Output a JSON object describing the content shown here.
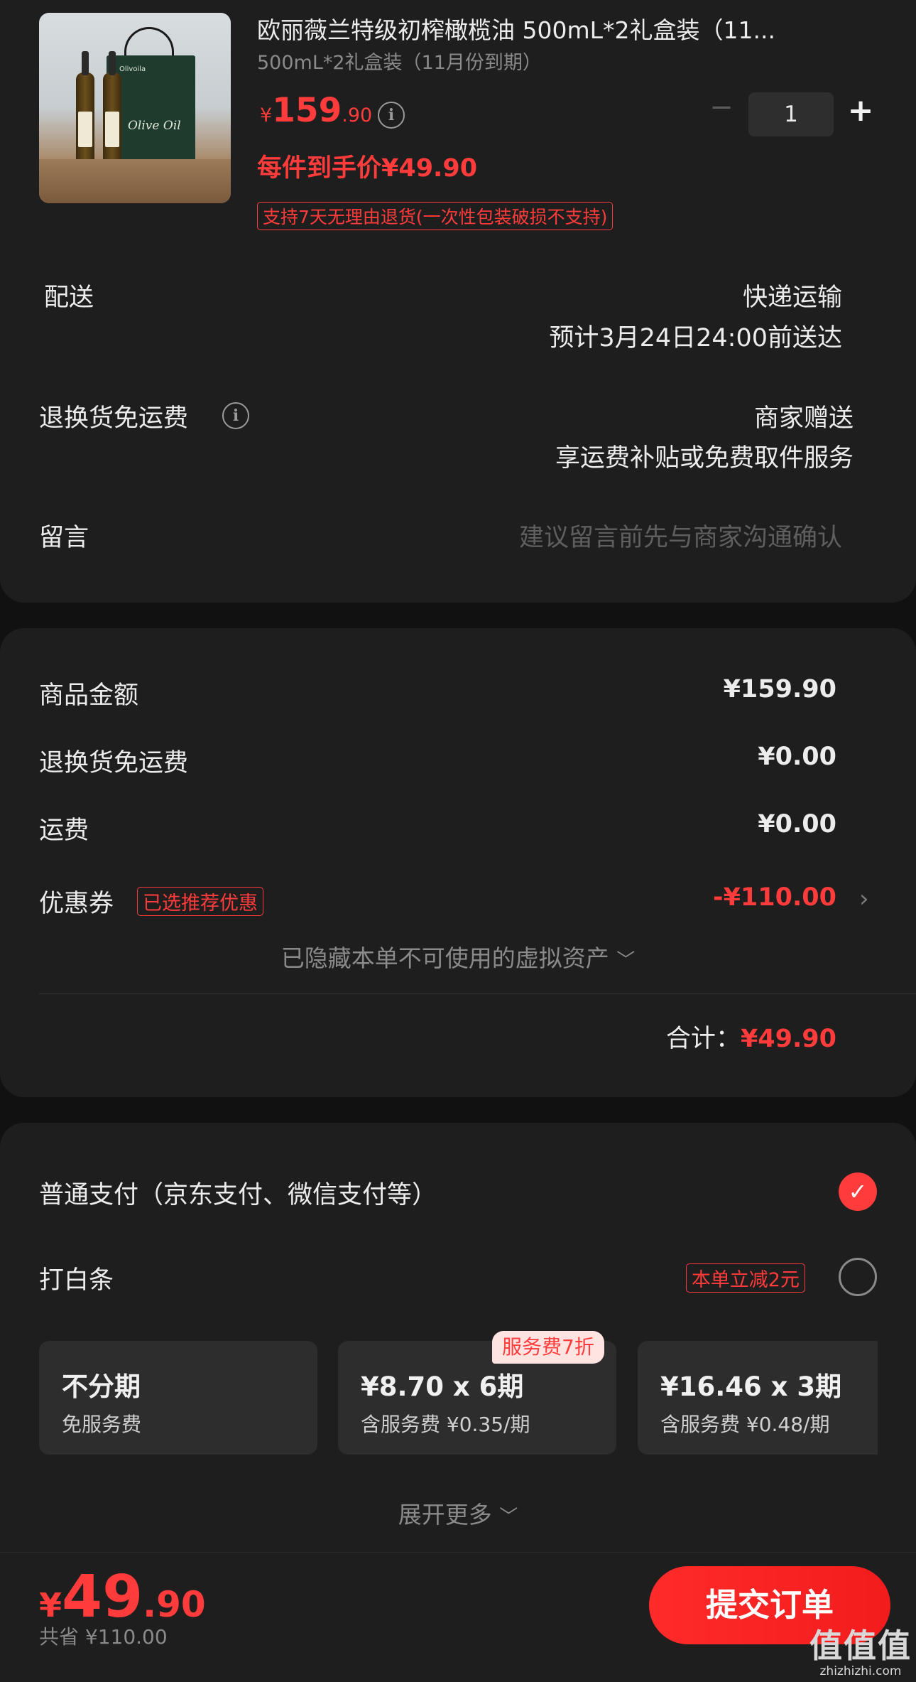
{
  "product": {
    "title": "欧丽薇兰特级初榨橄榄油 500mL*2礼盒装（11...",
    "spec": "500mL*2礼盒装（11月份到期）",
    "price": {
      "currency": "¥",
      "integer": "159",
      "decimal": ".90"
    },
    "unit_price": "每件到手价¥49.90",
    "return_tag": "支持7天无理由退货(一次性包装破损不支持)",
    "quantity": "1",
    "image_brand": "Olivoila",
    "image_label": "Olive Oil"
  },
  "delivery": {
    "label": "配送",
    "method": "快递运输",
    "eta": "预计3月24日24:00前送达"
  },
  "return_shipping": {
    "label": "退换货免运费",
    "value1": "商家赠送",
    "value2": "享运费补贴或免费取件服务"
  },
  "message": {
    "label": "留言",
    "placeholder": "建议留言前先与商家沟通确认"
  },
  "summary": {
    "goods_label": "商品金额",
    "goods_value": "¥159.90",
    "return_label": "退换货免运费",
    "return_value": "¥0.00",
    "shipping_label": "运费",
    "shipping_value": "¥0.00",
    "coupon_label": "优惠券",
    "coupon_tag": "已选推荐优惠",
    "coupon_value": "-¥110.00",
    "hidden_assets": "已隐藏本单不可使用的虚拟资产",
    "total_label": "合计：",
    "total_value": "¥49.90"
  },
  "payment": {
    "normal_label": "普通支付（京东支付、微信支付等）",
    "baitiao_label": "打白条",
    "baitiao_tag": "本单立减2元",
    "installments": [
      {
        "title": "不分期",
        "sub": "免服务费"
      },
      {
        "title": "¥8.70 x 6期",
        "sub": "含服务费 ¥0.35/期",
        "badge": "服务费7折"
      },
      {
        "title": "¥16.46 x 3期",
        "sub": "含服务费 ¥0.48/期"
      }
    ],
    "expand": "展开更多"
  },
  "footer": {
    "currency": "¥",
    "integer": "49",
    "decimal": ".90",
    "saved": "共省 ¥110.00",
    "submit": "提交订单"
  },
  "watermark": {
    "line1": "值值值",
    "line2": "zhizhizhi.com"
  },
  "colors": {
    "accent": "#ff3b3b",
    "background": "#111111",
    "card": "#1e1e1e"
  }
}
